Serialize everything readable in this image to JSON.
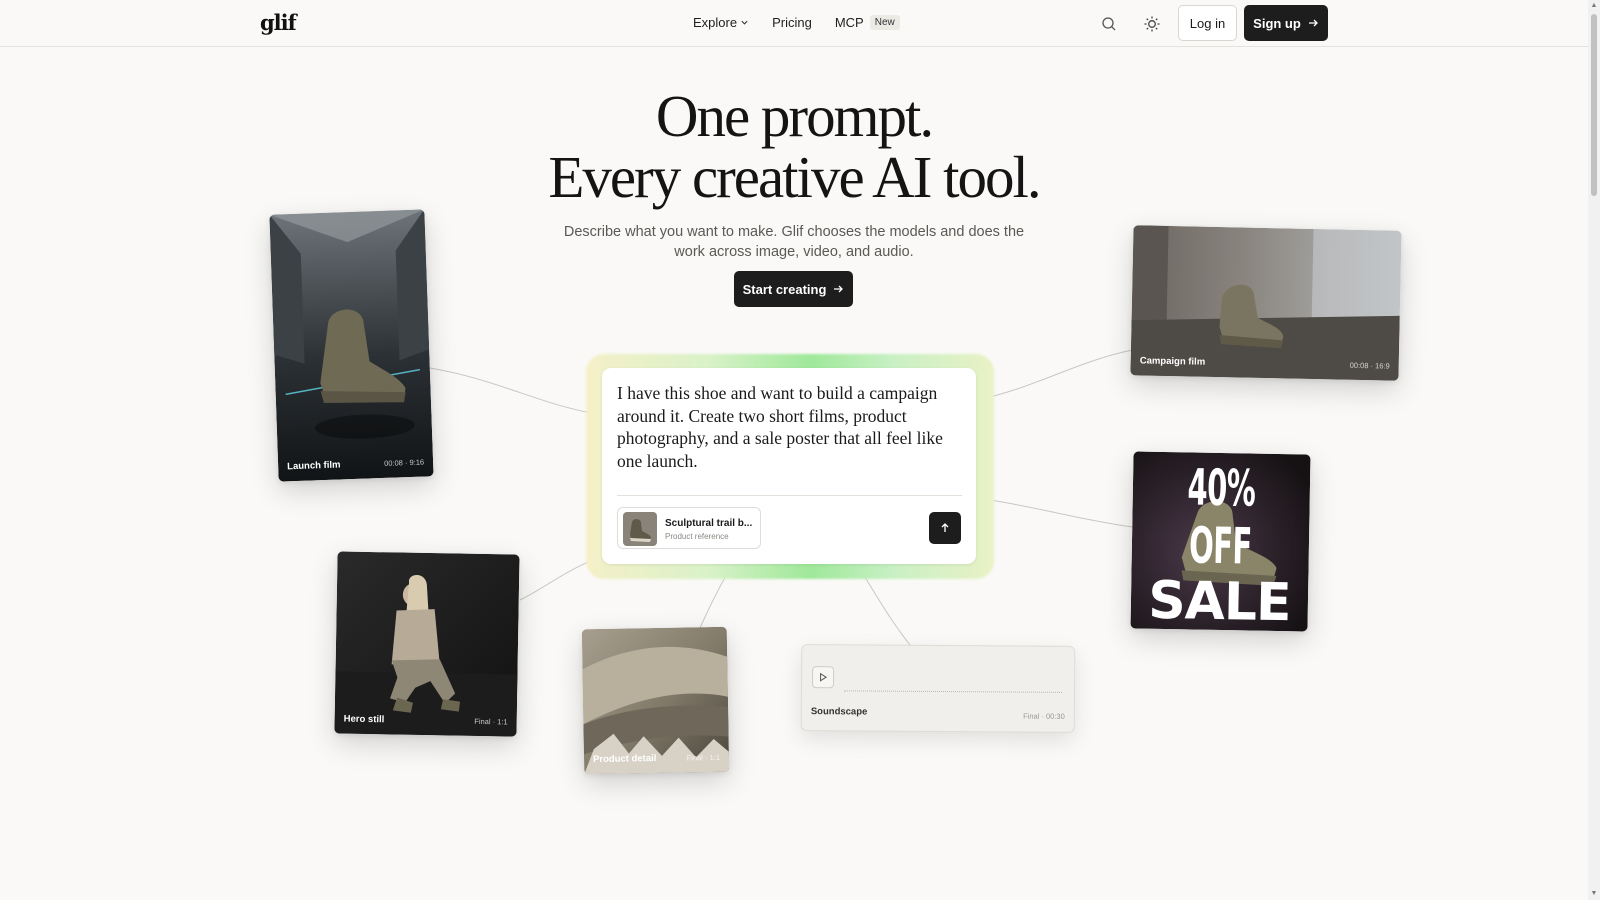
{
  "header": {
    "logo": "glif",
    "nav": [
      {
        "label": "Explore",
        "has_dropdown": true
      },
      {
        "label": "Pricing"
      },
      {
        "label": "MCP",
        "badge": "New"
      }
    ],
    "icons": {
      "search": "search-icon",
      "theme": "sun-icon"
    },
    "login_label": "Log in",
    "signup_label": "Sign up"
  },
  "hero": {
    "title_line1": "One prompt.",
    "title_line2": "Every creative AI tool.",
    "subtitle": "Describe what you want to make. Glif chooses the models and does the work across image, video, and audio.",
    "cta_label": "Start creating"
  },
  "prompt": {
    "text": "I have this shoe and want to build a campaign around it. Create two short films, product photography, and a sale poster that all feel like one launch.",
    "reference": {
      "title": "Sculptural trail b...",
      "subtitle": "Product reference"
    },
    "send_icon": "arrow-up-icon"
  },
  "cards": {
    "launch_film": {
      "label": "Launch film",
      "meta": "00:08 · 9:16"
    },
    "campaign_film": {
      "label": "Campaign film",
      "meta": "00:08 · 16:9"
    },
    "hero_still": {
      "label": "Hero still",
      "meta": "Final · 1:1"
    },
    "product_detail": {
      "label": "Product detail",
      "meta": "Final · 1:1"
    },
    "soundscape": {
      "label": "Soundscape",
      "meta": "Final · 00:30"
    },
    "sale_poster": {
      "headline": "40% OFF",
      "footer": "SALE"
    }
  },
  "colors": {
    "background": "#faf9f7",
    "button_dark": "#1d1d1d",
    "glow_green": "#9fe89a"
  }
}
